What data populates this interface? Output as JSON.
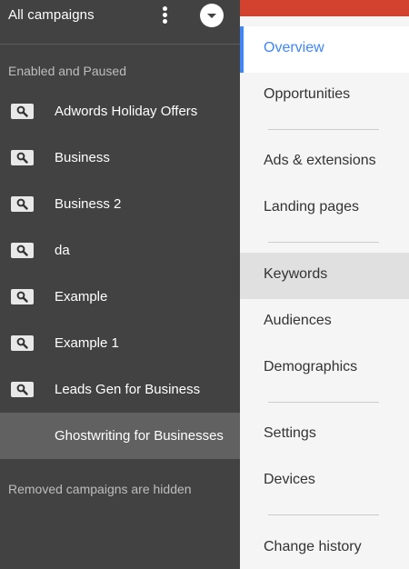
{
  "drawer": {
    "title": "All campaigns",
    "section_label": "Enabled and Paused",
    "campaigns": [
      {
        "name": "Adwords Holiday Offers",
        "icon": "search-icon"
      },
      {
        "name": "Business",
        "icon": "search-icon"
      },
      {
        "name": "Business 2",
        "icon": "search-icon"
      },
      {
        "name": "da",
        "icon": "search-icon"
      },
      {
        "name": "Example",
        "icon": "search-icon"
      },
      {
        "name": "Example 1",
        "icon": "search-icon"
      },
      {
        "name": "Leads Gen for Business",
        "icon": "search-icon"
      },
      {
        "name": "Ghostwriting for Businesses",
        "icon": ""
      }
    ],
    "footer_note": "Removed campaigns are hidden"
  },
  "nav": {
    "items": [
      {
        "label": "Overview"
      },
      {
        "label": "Opportunities"
      },
      {
        "label": "Ads & extensions"
      },
      {
        "label": "Landing pages"
      },
      {
        "label": "Keywords"
      },
      {
        "label": "Audiences"
      },
      {
        "label": "Demographics"
      },
      {
        "label": "Settings"
      },
      {
        "label": "Devices"
      },
      {
        "label": "Change history"
      }
    ]
  },
  "colors": {
    "drawer_bg": "#424242",
    "selected_row": "#616161",
    "accent_blue": "#4285f4",
    "top_bar_red": "#d3412f",
    "nav_bg": "#f5f5f5"
  }
}
